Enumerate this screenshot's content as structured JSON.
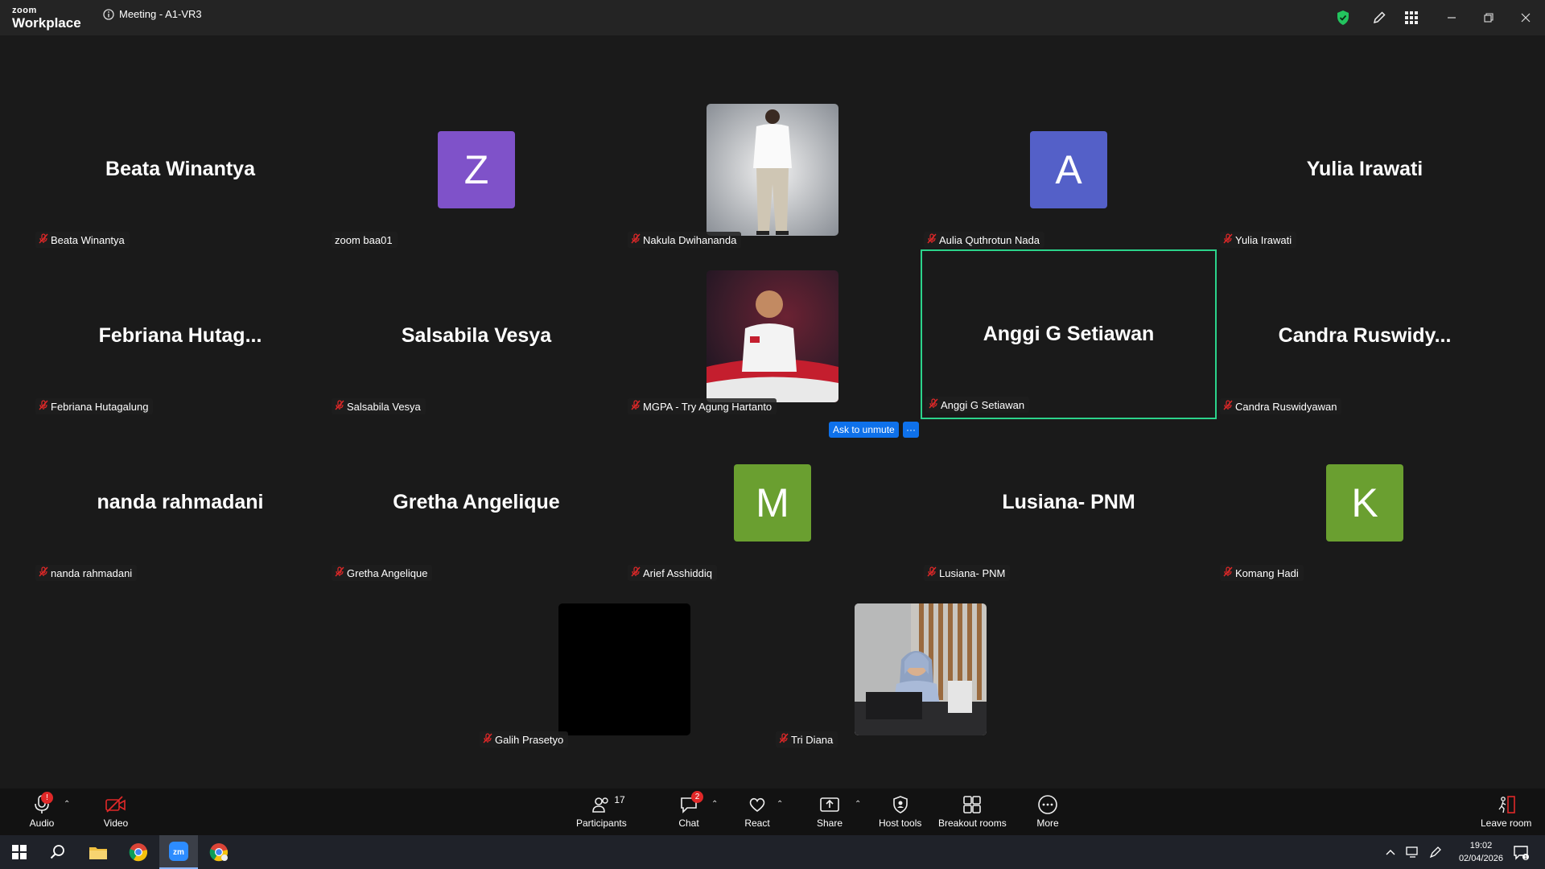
{
  "app": {
    "logo_top": "zoom",
    "logo_bottom": "Workplace",
    "meeting_title": "Meeting - A1-VR3"
  },
  "colors": {
    "active_speaker": "#2bd38b",
    "ask_button": "#0e71eb",
    "muted": "#e02828"
  },
  "tiles": [
    {
      "name": "Beata Winantya",
      "display": "Beata Winantya",
      "kind": "name"
    },
    {
      "name": "zoom baa01",
      "display": "Z",
      "kind": "avatar",
      "color": "#7f52c9"
    },
    {
      "name": "Nakula Dwihananda",
      "display": "",
      "kind": "photo"
    },
    {
      "name": "Aulia Quthrotun Nada",
      "display": "A",
      "kind": "avatar",
      "color": "#5460c8"
    },
    {
      "name": "Yulia Irawati",
      "display": "Yulia Irawati",
      "kind": "name"
    },
    {
      "name": "Febriana Hutagalung",
      "display": "Febriana  Hutag...",
      "kind": "name"
    },
    {
      "name": "Salsabila Vesya",
      "display": "Salsabila Vesya",
      "kind": "name"
    },
    {
      "name": "MGPA - Try Agung Hartanto",
      "display": "",
      "kind": "photo"
    },
    {
      "name": "Anggi G Setiawan",
      "display": "Anggi G Setiawan",
      "kind": "name",
      "active": true
    },
    {
      "name": "Candra Ruswidyawan",
      "display": "Candra  Ruswidy...",
      "kind": "name"
    },
    {
      "name": "nanda rahmadani",
      "display": "nanda rahmadani",
      "kind": "name"
    },
    {
      "name": "Gretha Angelique",
      "display": "Gretha Angelique",
      "kind": "name"
    },
    {
      "name": "Arief Asshiddiq",
      "display": "M",
      "kind": "avatar",
      "color": "#6a9f30"
    },
    {
      "name": "Lusiana- PNM",
      "display": "Lusiana- PNM",
      "kind": "name"
    },
    {
      "name": "Komang Hadi",
      "display": "K",
      "kind": "avatar",
      "color": "#6a9f30"
    },
    {
      "name": "Galih Prasetyo",
      "display": "",
      "kind": "black"
    },
    {
      "name": "Tri Diana",
      "display": "",
      "kind": "photo"
    }
  ],
  "ask_to_unmute": {
    "label": "Ask to unmute",
    "more": "···"
  },
  "toolbar": {
    "audio": "Audio",
    "audio_badge": "!",
    "video": "Video",
    "participants": "Participants",
    "participants_count": "17",
    "chat": "Chat",
    "chat_badge": "2",
    "react": "React",
    "share": "Share",
    "host_tools": "Host tools",
    "breakout_rooms": "Breakout rooms",
    "more": "More",
    "leave": "Leave room"
  },
  "taskbar": {
    "time": "19:02",
    "date": "02/04/2026"
  }
}
